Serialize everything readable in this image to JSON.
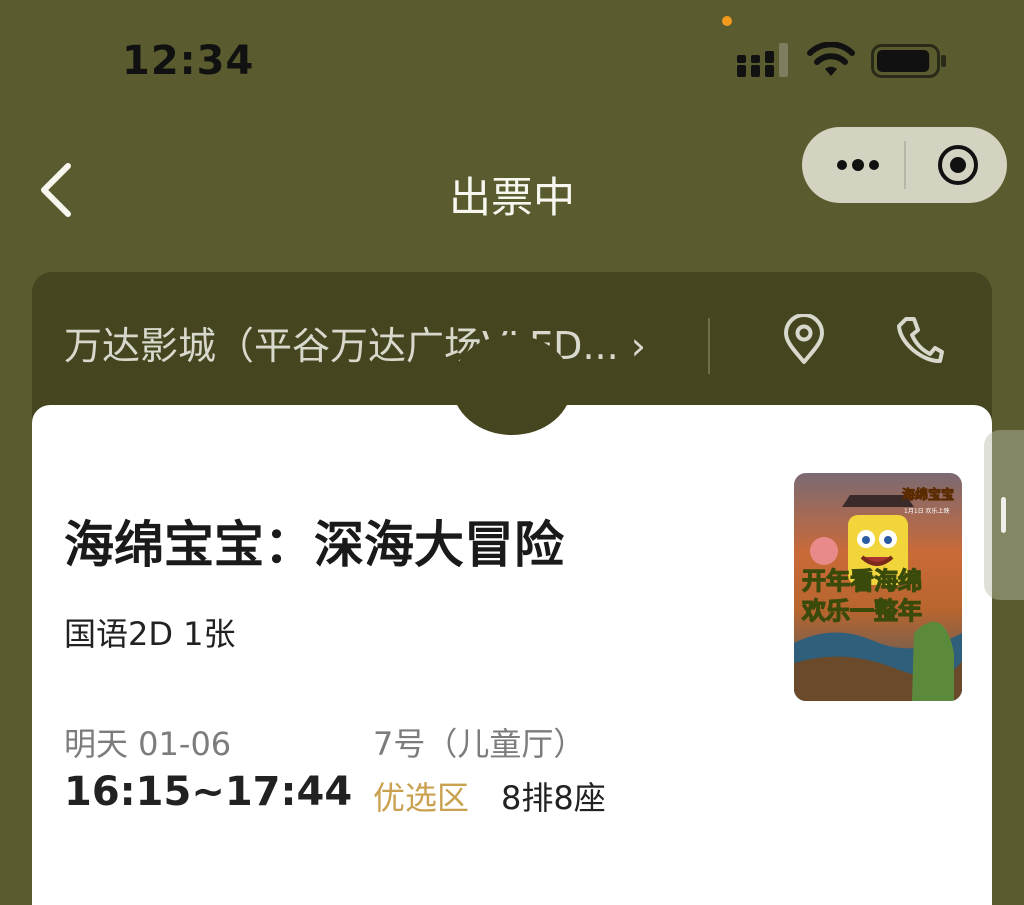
{
  "status_bar": {
    "time": "12:34",
    "battery_level": 0.9
  },
  "nav": {
    "title": "出票中",
    "back_icon": "chevron-left-icon",
    "more_icon": "more-dots-icon",
    "close_icon": "target-close-icon"
  },
  "cinema": {
    "name": "万达影城（平谷万达广场VLED...",
    "chevron": "›",
    "location_icon": "location-pin-icon",
    "phone_icon": "phone-icon"
  },
  "ticket": {
    "movie_title": "海绵宝宝：深海大冒险",
    "format": "国语2D 1张",
    "date": "明天 01-06",
    "time_range": "16:15~17:44",
    "hall": "7号（儿童厅）",
    "zone": "优选区",
    "seat": "8排8座"
  },
  "poster": {
    "corner_title": "海绵宝宝",
    "corner_sub": "1月1日 欢乐上映",
    "slogan_line1": "开年看海绵",
    "slogan_line2": "欢乐一整年"
  },
  "colors": {
    "background": "#5a5c2f",
    "card_dark": "#45461f",
    "accent_zone": "#c9a14f",
    "capsule": "#d4d2c0"
  }
}
